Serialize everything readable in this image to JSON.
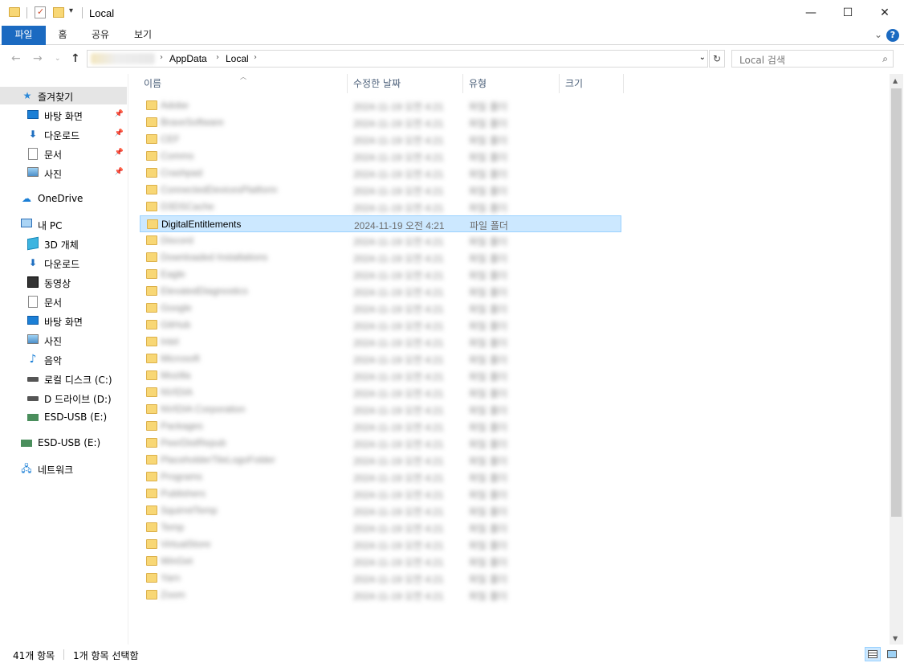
{
  "window": {
    "title": "Local",
    "minimize": "—",
    "maximize": "☐",
    "close": "✕"
  },
  "ribbon": {
    "tabs": [
      "파일",
      "홈",
      "공유",
      "보기"
    ]
  },
  "address": {
    "blurred_segment": "",
    "crumbs": [
      "AppData",
      "Local"
    ],
    "search_placeholder": "Local 검색"
  },
  "nav": {
    "quick_access": "즐겨찾기",
    "qa_items": [
      "바탕 화면",
      "다운로드",
      "문서",
      "사진"
    ],
    "onedrive": "OneDrive",
    "this_pc": "내 PC",
    "pc_items": [
      "3D 개체",
      "다운로드",
      "동영상",
      "문서",
      "바탕 화면",
      "사진",
      "음악",
      "로컬 디스크 (C:)",
      "D 드라이브 (D:)",
      "ESD-USB (E:)"
    ],
    "usb": "ESD-USB (E:)",
    "network": "네트워크"
  },
  "columns": {
    "name": "이름",
    "date": "수정한 날짜",
    "type": "유형",
    "size": "크기"
  },
  "files": {
    "blurred_before": [
      "Adobe",
      "BraveSoftware",
      "CEF",
      "Comms",
      "Crashpad",
      "ConnectedDevicesPlatform",
      "D3DSCache"
    ],
    "selected": {
      "name": "DigitalEntitlements",
      "date": "2024-11-19 오전 4:21",
      "type": "파일 폴더"
    },
    "blurred_after": [
      "Discord",
      "Downloaded Installations",
      "Eagle",
      "ElevatedDiagnostics",
      "Google",
      "GitHub",
      "Intel",
      "Microsoft",
      "Mozilla",
      "NVIDIA",
      "NVIDIA Corporation",
      "Packages",
      "PeerDistRepub",
      "PlaceholderTileLogoFolder",
      "Programs",
      "Publishers",
      "SquirrelTemp",
      "Temp",
      "VirtualStore",
      "WinGet",
      "Yarn",
      "Zoom"
    ],
    "blurred_date": "2024-11-19 오전 4:21",
    "blurred_type": "파일 폴더"
  },
  "status": {
    "count": "41개 항목",
    "selection": "1개 항목 선택함"
  }
}
